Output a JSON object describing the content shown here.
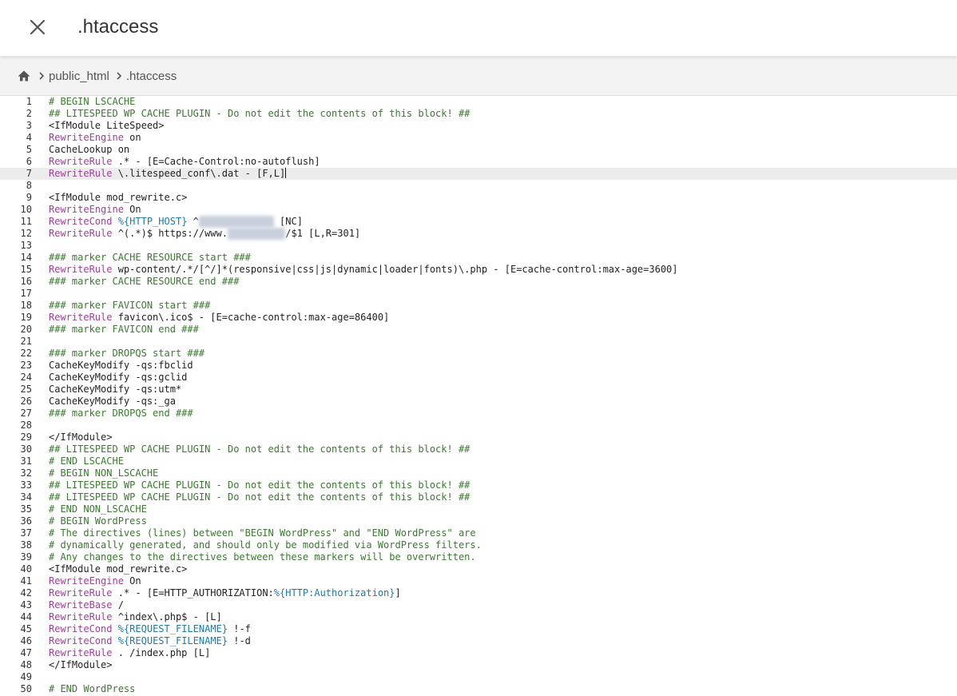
{
  "header": {
    "title": ".htaccess",
    "close_icon": "close-icon"
  },
  "breadcrumb": {
    "home_icon": "home-icon",
    "items": [
      "public_html",
      ".htaccess"
    ]
  },
  "colors": {
    "directive": "#a0409a",
    "comment": "#3a7a2e",
    "variable": "#1f7aa8",
    "breadcrumb_bg": "#f3f3f3",
    "active_line": "#ececec"
  },
  "editor": {
    "active_line": 7,
    "lines": [
      {
        "n": "1",
        "t": [
          {
            "k": "c",
            "s": "# BEGIN LSCACHE"
          }
        ]
      },
      {
        "n": "2",
        "t": [
          {
            "k": "c",
            "s": "## LITESPEED WP CACHE PLUGIN - Do not edit the contents of this block! ##"
          }
        ]
      },
      {
        "n": "3",
        "t": [
          {
            "k": "",
            "s": "<IfModule LiteSpeed>"
          }
        ]
      },
      {
        "n": "4",
        "t": [
          {
            "k": "kw",
            "s": "RewriteEngine"
          },
          {
            "k": "",
            "s": " on"
          }
        ]
      },
      {
        "n": "5",
        "t": [
          {
            "k": "",
            "s": "CacheLookup on"
          }
        ]
      },
      {
        "n": "6",
        "t": [
          {
            "k": "kw",
            "s": "RewriteRule"
          },
          {
            "k": "",
            "s": " .* - [E=Cache-Control:no-autoflush]"
          }
        ]
      },
      {
        "n": "7",
        "t": [
          {
            "k": "kw",
            "s": "RewriteRule"
          },
          {
            "k": "",
            "s": " \\.litespeed_conf\\.dat - [F,L]"
          }
        ]
      },
      {
        "n": "8",
        "t": []
      },
      {
        "n": "9",
        "t": [
          {
            "k": "",
            "s": "<IfModule mod_rewrite.c>"
          }
        ]
      },
      {
        "n": "10",
        "t": [
          {
            "k": "kw",
            "s": "RewriteEngine"
          },
          {
            "k": "",
            "s": " On"
          }
        ]
      },
      {
        "n": "11",
        "t": [
          {
            "k": "kw",
            "s": "RewriteCond"
          },
          {
            "k": "",
            "s": " "
          },
          {
            "k": "v",
            "s": "%{HTTP_HOST}"
          },
          {
            "k": "",
            "s": " ^"
          },
          {
            "k": "blur",
            "s": "xxxxxxxxxxxxx"
          },
          {
            "k": "",
            "s": " [NC]"
          }
        ]
      },
      {
        "n": "12",
        "t": [
          {
            "k": "kw",
            "s": "RewriteRule"
          },
          {
            "k": "",
            "s": " ^(.*)$ https://www."
          },
          {
            "k": "blur",
            "s": "xxxxxxxxxx"
          },
          {
            "k": "",
            "s": "/$1 [L,R=301]"
          }
        ]
      },
      {
        "n": "13",
        "t": []
      },
      {
        "n": "14",
        "t": [
          {
            "k": "c",
            "s": "### marker CACHE RESOURCE start ###"
          }
        ]
      },
      {
        "n": "15",
        "t": [
          {
            "k": "kw",
            "s": "RewriteRule"
          },
          {
            "k": "",
            "s": " wp-content/.*/[^/]*(responsive|css|js|dynamic|loader|fonts)\\.php - [E=cache-control:max-age=3600]"
          }
        ]
      },
      {
        "n": "16",
        "t": [
          {
            "k": "c",
            "s": "### marker CACHE RESOURCE end ###"
          }
        ]
      },
      {
        "n": "17",
        "t": []
      },
      {
        "n": "18",
        "t": [
          {
            "k": "c",
            "s": "### marker FAVICON start ###"
          }
        ]
      },
      {
        "n": "19",
        "t": [
          {
            "k": "kw",
            "s": "RewriteRule"
          },
          {
            "k": "",
            "s": " favicon\\.ico$ - [E=cache-control:max-age=86400]"
          }
        ]
      },
      {
        "n": "20",
        "t": [
          {
            "k": "c",
            "s": "### marker FAVICON end ###"
          }
        ]
      },
      {
        "n": "21",
        "t": []
      },
      {
        "n": "22",
        "t": [
          {
            "k": "c",
            "s": "### marker DROPQS start ###"
          }
        ]
      },
      {
        "n": "23",
        "t": [
          {
            "k": "",
            "s": "CacheKeyModify -qs:fbclid"
          }
        ]
      },
      {
        "n": "24",
        "t": [
          {
            "k": "",
            "s": "CacheKeyModify -qs:gclid"
          }
        ]
      },
      {
        "n": "25",
        "t": [
          {
            "k": "",
            "s": "CacheKeyModify -qs:utm*"
          }
        ]
      },
      {
        "n": "26",
        "t": [
          {
            "k": "",
            "s": "CacheKeyModify -qs:_ga"
          }
        ]
      },
      {
        "n": "27",
        "t": [
          {
            "k": "c",
            "s": "### marker DROPQS end ###"
          }
        ]
      },
      {
        "n": "28",
        "t": []
      },
      {
        "n": "29",
        "t": [
          {
            "k": "",
            "s": "</IfModule>"
          }
        ]
      },
      {
        "n": "30",
        "t": [
          {
            "k": "c",
            "s": "## LITESPEED WP CACHE PLUGIN - Do not edit the contents of this block! ##"
          }
        ]
      },
      {
        "n": "31",
        "t": [
          {
            "k": "c",
            "s": "# END LSCACHE"
          }
        ]
      },
      {
        "n": "32",
        "t": [
          {
            "k": "c",
            "s": "# BEGIN NON_LSCACHE"
          }
        ]
      },
      {
        "n": "33",
        "t": [
          {
            "k": "c",
            "s": "## LITESPEED WP CACHE PLUGIN - Do not edit the contents of this block! ##"
          }
        ]
      },
      {
        "n": "34",
        "t": [
          {
            "k": "c",
            "s": "## LITESPEED WP CACHE PLUGIN - Do not edit the contents of this block! ##"
          }
        ]
      },
      {
        "n": "35",
        "t": [
          {
            "k": "c",
            "s": "# END NON_LSCACHE"
          }
        ]
      },
      {
        "n": "36",
        "t": [
          {
            "k": "c",
            "s": "# BEGIN WordPress"
          }
        ]
      },
      {
        "n": "37",
        "t": [
          {
            "k": "c",
            "s": "# The directives (lines) between \"BEGIN WordPress\" and \"END WordPress\" are"
          }
        ]
      },
      {
        "n": "38",
        "t": [
          {
            "k": "c",
            "s": "# dynamically generated, and should only be modified via WordPress filters."
          }
        ]
      },
      {
        "n": "39",
        "t": [
          {
            "k": "c",
            "s": "# Any changes to the directives between these markers will be overwritten."
          }
        ]
      },
      {
        "n": "40",
        "t": [
          {
            "k": "",
            "s": "<IfModule mod_rewrite.c>"
          }
        ]
      },
      {
        "n": "41",
        "t": [
          {
            "k": "kw",
            "s": "RewriteEngine"
          },
          {
            "k": "",
            "s": " On"
          }
        ]
      },
      {
        "n": "42",
        "t": [
          {
            "k": "kw",
            "s": "RewriteRule"
          },
          {
            "k": "",
            "s": " .* - [E=HTTP_AUTHORIZATION:"
          },
          {
            "k": "v",
            "s": "%{HTTP:Authorization}"
          },
          {
            "k": "",
            "s": "]"
          }
        ]
      },
      {
        "n": "43",
        "t": [
          {
            "k": "kw",
            "s": "RewriteBase"
          },
          {
            "k": "",
            "s": " /"
          }
        ]
      },
      {
        "n": "44",
        "t": [
          {
            "k": "kw",
            "s": "RewriteRule"
          },
          {
            "k": "",
            "s": " ^index\\.php$ - [L]"
          }
        ]
      },
      {
        "n": "45",
        "t": [
          {
            "k": "kw",
            "s": "RewriteCond"
          },
          {
            "k": "",
            "s": " "
          },
          {
            "k": "v",
            "s": "%{REQUEST_FILENAME}"
          },
          {
            "k": "",
            "s": " !-f"
          }
        ]
      },
      {
        "n": "46",
        "t": [
          {
            "k": "kw",
            "s": "RewriteCond"
          },
          {
            "k": "",
            "s": " "
          },
          {
            "k": "v",
            "s": "%{REQUEST_FILENAME}"
          },
          {
            "k": "",
            "s": " !-d"
          }
        ]
      },
      {
        "n": "47",
        "t": [
          {
            "k": "kw",
            "s": "RewriteRule"
          },
          {
            "k": "",
            "s": " . /index.php [L]"
          }
        ]
      },
      {
        "n": "48",
        "t": [
          {
            "k": "",
            "s": "</IfModule>"
          }
        ]
      },
      {
        "n": "49",
        "t": []
      },
      {
        "n": "50",
        "t": [
          {
            "k": "c",
            "s": "# END WordPress"
          }
        ]
      }
    ]
  }
}
